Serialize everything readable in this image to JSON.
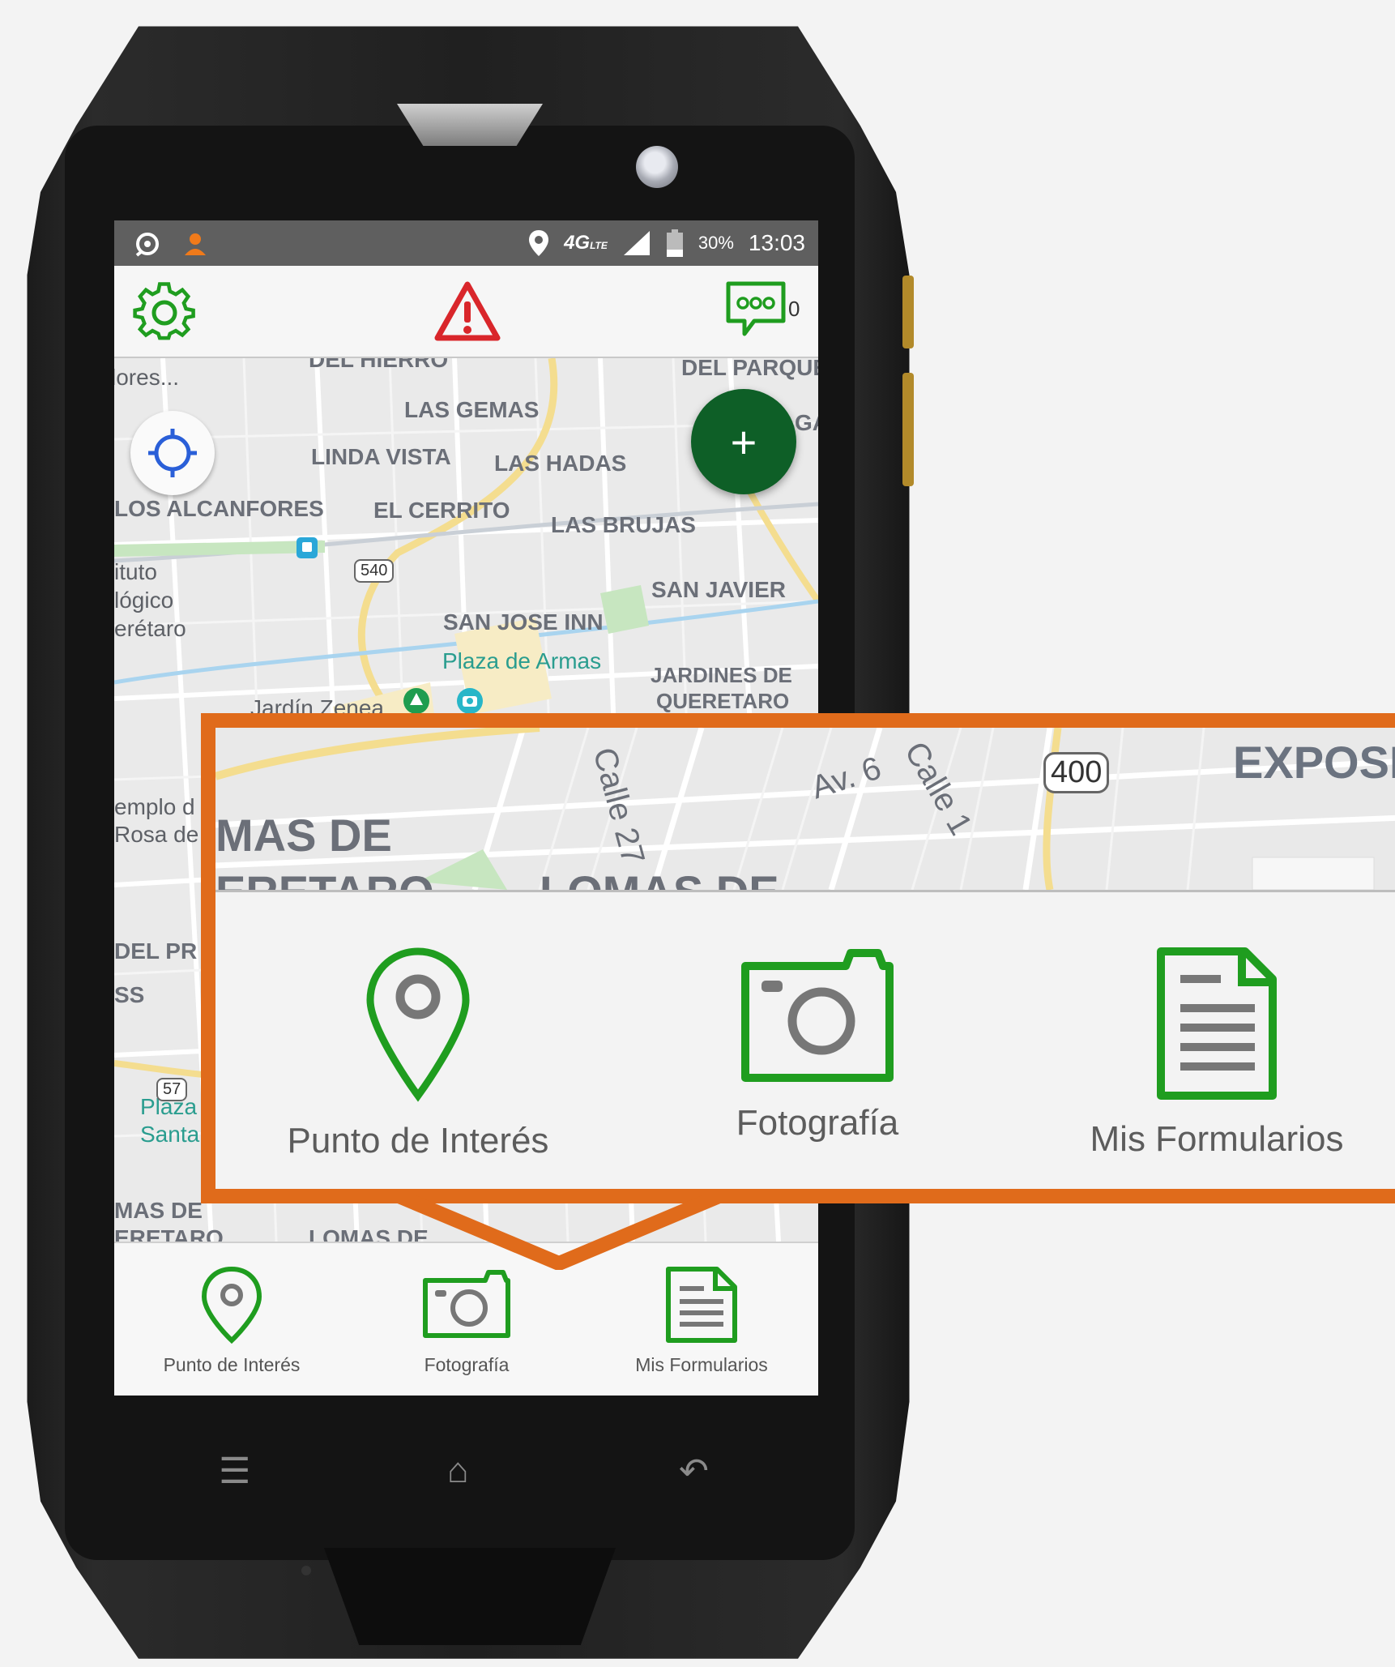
{
  "statusbar": {
    "network": "4G",
    "network_sub": "LTE",
    "battery": "30%",
    "time": "13:03"
  },
  "toolbar": {
    "messages_count": "0",
    "icons": [
      "gear-icon",
      "warning-icon",
      "chat-bubble-icon"
    ]
  },
  "map": {
    "labels": [
      "DEL HIERRO",
      "DEL PARQUE",
      "lores...",
      "LAS GEMAS",
      "GA",
      "LINDA VISTA",
      "LAS HADAS",
      "LOS ALCANFORES",
      "EL CERRITO",
      "LAS BRUJAS",
      "ituto",
      "lógico",
      "erétaro",
      "SAN JAVIER",
      "SAN JOSE INN",
      "Plaza de Armas",
      "JARDINES DE",
      "QUERETARO",
      "Jardín Zenea",
      "emplo d",
      "Rosa de",
      "DEL PR",
      "SS",
      "Plaza",
      "Santa",
      "MAS DE",
      "ERETARO",
      "LOMAS DE"
    ],
    "road_badges": [
      "540",
      "57"
    ],
    "fab_label": "+"
  },
  "bottom_nav": [
    {
      "label": "Punto de Interés",
      "icon": "map-pin-icon"
    },
    {
      "label": "Fotografía",
      "icon": "camera-icon"
    },
    {
      "label": "Mis Formularios",
      "icon": "document-icon"
    }
  ],
  "callout": {
    "map_labels": [
      "Calle 27",
      "Av. 6",
      "Calle 1",
      "EXPOSIT",
      "MAS DE",
      "ERETARO",
      "LOMAS DE"
    ],
    "road_badge": "400",
    "items": [
      {
        "label": "Punto de Interés",
        "icon": "map-pin-icon"
      },
      {
        "label": "Fotografía",
        "icon": "camera-icon"
      },
      {
        "label": "Mis Formularios",
        "icon": "document-icon"
      }
    ]
  },
  "colors": {
    "accent_green": "#1f9d1f",
    "fab_green": "#0e5f27",
    "warning_red": "#d9262b",
    "callout_orange": "#e06b1b",
    "locate_blue": "#2a5fd8"
  }
}
